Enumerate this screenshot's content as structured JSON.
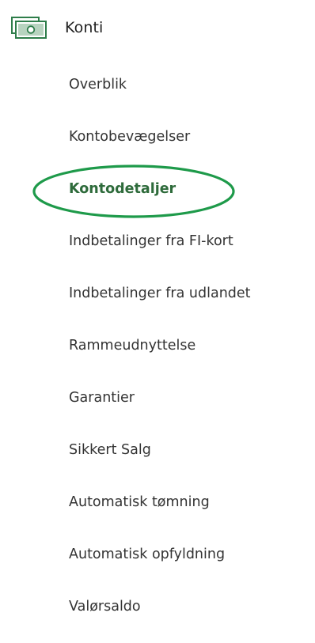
{
  "section": {
    "title": "Konti",
    "icon": "banknote-icon",
    "icon_color": "#2e7d4a"
  },
  "menu": {
    "items": [
      {
        "label": "Overblik"
      },
      {
        "label": "Kontobevægelser"
      },
      {
        "label": "Kontodetaljer",
        "active": true
      },
      {
        "label": "Indbetalinger fra FI-kort"
      },
      {
        "label": "Indbetalinger fra udlandet"
      },
      {
        "label": "Rammeudnyttelse"
      },
      {
        "label": "Garantier"
      },
      {
        "label": "Sikkert Salg"
      },
      {
        "label": "Automatisk tømning"
      },
      {
        "label": "Automatisk opfyldning"
      },
      {
        "label": "Valørsaldo"
      }
    ]
  },
  "colors": {
    "active_text": "#2e6b3b",
    "highlight_ring": "#1e9a4a",
    "text": "#333333"
  }
}
